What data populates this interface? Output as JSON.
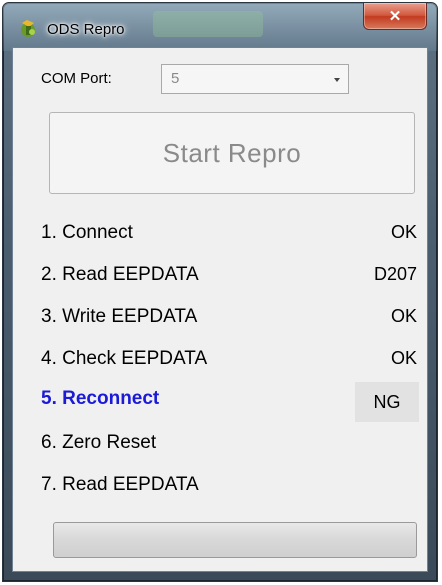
{
  "window": {
    "title": "ODS Repro",
    "close_label": "✕"
  },
  "com_port": {
    "label": "COM Port:",
    "value": "5"
  },
  "start_button": {
    "label": "Start Repro"
  },
  "steps": [
    {
      "label": "1. Connect",
      "result": "OK"
    },
    {
      "label": "2. Read EEPDATA",
      "result": "D207"
    },
    {
      "label": "3. Write EEPDATA",
      "result": "OK"
    },
    {
      "label": "4. Check EEPDATA",
      "result": "OK"
    },
    {
      "label": "5. Reconnect",
      "result": "NG",
      "active": true
    },
    {
      "label": "6. Zero Reset",
      "result": ""
    },
    {
      "label": "7. Read EEPDATA",
      "result": ""
    }
  ],
  "progress": {
    "value": 0
  },
  "colors": {
    "active_step": "#1a1ad8",
    "close_button": "#c23a1f"
  },
  "icons": {
    "app": "app-icon",
    "dropdown": "chevron-down-icon"
  }
}
